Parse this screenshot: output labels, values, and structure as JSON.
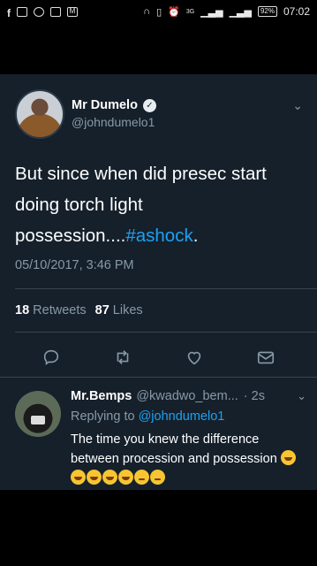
{
  "status_bar": {
    "left_icons": [
      "facebook-icon",
      "message-icon",
      "whatsapp-icon",
      "gallery-icon",
      "gmail-icon"
    ],
    "right_icons": [
      "headphones-icon",
      "vibrate-icon",
      "alarm-icon"
    ],
    "network_label": "3G",
    "battery": "92%",
    "time": "07:02"
  },
  "tweet": {
    "author_name": "Mr Dumelo",
    "author_handle": "@johndumelo1",
    "text_main": "But since when did presec start doing torch light possession....",
    "hashtag": "#ashock",
    "text_tail": ".",
    "date": "05/10/2017, 3:46 PM",
    "retweets_count": "18",
    "retweets_label": "Retweets",
    "likes_count": "87",
    "likes_label": "Likes"
  },
  "actions": {
    "icons": [
      "reply-icon",
      "retweet-icon",
      "like-icon",
      "share-icon"
    ]
  },
  "reply": {
    "author_name": "Mr.Bemps",
    "author_handle": "@kwadwo_bem...",
    "time": "· 2s",
    "replying_prefix": "Replying to",
    "replying_mention": "@johndumelo1",
    "text": "The time you knew the difference between procession and possession",
    "emoji_laugh_count": 5,
    "emoji_think_count": 2
  },
  "colors": {
    "card_bg": "#15202b",
    "accent": "#1da1f2",
    "muted": "#8899a6"
  }
}
